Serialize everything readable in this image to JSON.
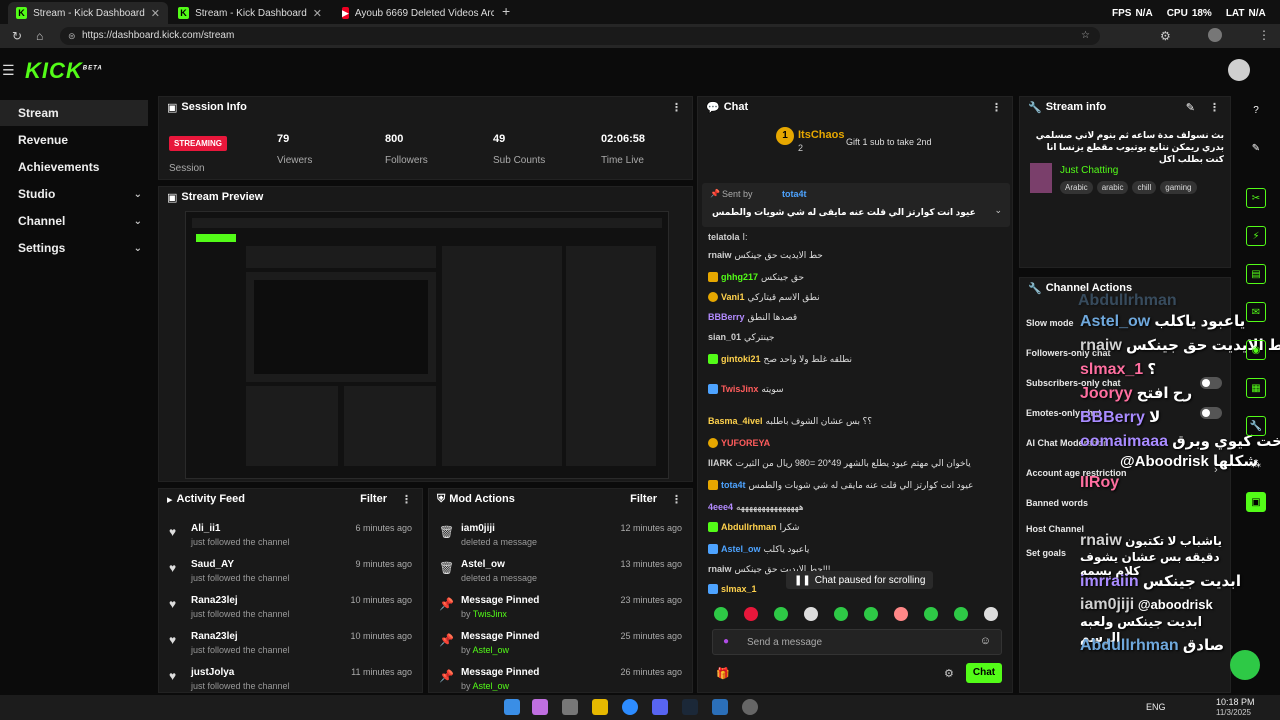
{
  "browser": {
    "tabs": [
      {
        "title": "Stream - Kick Dashboard"
      },
      {
        "title": "Stream - Kick Dashboard"
      },
      {
        "title": "Ayoub 6669 Deleted Videos Archi"
      }
    ],
    "url": "https://dashboard.kick.com/stream",
    "sys": {
      "fps": "FPS",
      "fps_val": "N/A",
      "cpu": "CPU",
      "cpu_val": "18%",
      "lat": "LAT",
      "lat_val": "N/A"
    }
  },
  "app": {
    "logo": "KICK",
    "logo_sup": "BETA",
    "accent": "#53fc18"
  },
  "sidebar": {
    "items": [
      {
        "label": "Stream"
      },
      {
        "label": "Revenue"
      },
      {
        "label": "Achievements"
      },
      {
        "label": "Studio"
      },
      {
        "label": "Channel"
      },
      {
        "label": "Settings"
      }
    ]
  },
  "session": {
    "title": "Session Info",
    "status": "STREAMING",
    "status_label": "Session",
    "stats": [
      {
        "value": "79",
        "label": "Viewers"
      },
      {
        "value": "800",
        "label": "Followers"
      },
      {
        "value": "49",
        "label": "Sub Counts"
      },
      {
        "value": "02:06:58",
        "label": "Time Live"
      }
    ]
  },
  "preview": {
    "title": "Stream Preview"
  },
  "activity": {
    "title": "Activity Feed",
    "filter": "Filter",
    "items": [
      {
        "name": "Ali_ii1",
        "sub": "just followed the channel",
        "time": "6 minutes ago"
      },
      {
        "name": "Saud_AY",
        "sub": "just followed the channel",
        "time": "9 minutes ago"
      },
      {
        "name": "Rana23lej",
        "sub": "just followed the channel",
        "time": "10 minutes ago"
      },
      {
        "name": "Rana23lej",
        "sub": "just followed the channel",
        "time": "10 minutes ago"
      },
      {
        "name": "justJolya",
        "sub": "just followed the channel",
        "time": "11 minutes ago"
      }
    ]
  },
  "mod": {
    "title": "Mod Actions",
    "filter": "Filter",
    "items": [
      {
        "name": "iam0jiji",
        "sub": "deleted a message",
        "by": "",
        "time": "12 minutes ago"
      },
      {
        "name": "Astel_ow",
        "sub": "deleted a message",
        "by": "",
        "time": "13 minutes ago"
      },
      {
        "name": "Message Pinned",
        "sub": "by ",
        "by": "TwisJinx",
        "time": "23 minutes ago"
      },
      {
        "name": "Message Pinned",
        "sub": "by ",
        "by": "Astel_ow",
        "time": "25 minutes ago"
      },
      {
        "name": "Message Pinned",
        "sub": "by ",
        "by": "Astel_ow",
        "time": "26 minutes ago"
      }
    ]
  },
  "chat": {
    "title": "Chat",
    "top_user": "ItsChaos",
    "top_count": "2",
    "gift": "Gift 1 sub to take 2nd",
    "pinned_sent_by": "Sent by",
    "pinned_user": "tota4t",
    "pinned_msg": "عيود انت كوارتز الي قلت عنه مايقى له شي شويات والطمس",
    "messages": [
      {
        "user": "telatola",
        "text": "ا:",
        "color": "#cfcfcf"
      },
      {
        "user": "rnaiw",
        "text": "حط الايديت حق جينكس",
        "color": "#cfcfcf"
      },
      {
        "user": "ghhg217",
        "text": "حق جينكس",
        "color": "#53fc18"
      },
      {
        "user": "Vani1",
        "text": "نطق الاسم قيتاركي",
        "color": "#ffd24d"
      },
      {
        "user": "BBBerry",
        "text": "قصدها النطق",
        "color": "#b38bff"
      },
      {
        "user": "sian_01",
        "text": "جينتركي",
        "color": "#cfcfcf"
      },
      {
        "user": "gintoki21",
        "text": "نطلقه غلط ولا واحد صح",
        "color": "#ffd24d"
      },
      {
        "user": "TwisJinx",
        "text": "سويته",
        "color": "#ff5c5c"
      },
      {
        "user": "Basma_4ivel",
        "text": "؟؟ بس عشان الشوف باطلبه",
        "color": "#ffd24d"
      },
      {
        "user": "YUFOREYA",
        "text": "",
        "color": "#ff5c5c"
      },
      {
        "user": "IIARK",
        "text": "ياخوان الي مهتم عيود يطلع بالشهر 49*20 =980 ريال من الثيرت",
        "color": "#cfcfcf"
      },
      {
        "user": "tota4t",
        "text": "عيود انت كوارتز الي قلت عنه مايقى له شي شويات والطمس",
        "color": "#4da3ff"
      },
      {
        "user": "4eee4",
        "text": "هههههههههههههههه",
        "color": "#b38bff"
      },
      {
        "user": "Abdullrhman",
        "text": "شكرا",
        "color": "#ffd24d"
      },
      {
        "user": "Astel_ow",
        "text": "ياعبود ياكلب",
        "color": "#4da3ff"
      },
      {
        "user": "rnaiw",
        "text": "حط الايديت حق جينكس!!!",
        "color": "#cfcfcf"
      },
      {
        "user": "slmax_1",
        "text": "",
        "color": "#ffd24d"
      }
    ],
    "paused": "Chat paused for scrolling",
    "placeholder": "Send a message",
    "send": "Chat"
  },
  "stream_info": {
    "title": "Stream info",
    "description": "بث نسولف مدة ساعه ثم بنوم لاني صسلمي بدري ريمكن نتابع يوتيوب مقطع يزنسا انا كنت بطلب اكل",
    "category": "Just Chatting",
    "tags": [
      "Arabic",
      "arabic",
      "chill",
      "gaming"
    ]
  },
  "channel_actions": {
    "title": "Channel Actions",
    "items": [
      {
        "label": "Slow mode"
      },
      {
        "label": "Followers-only chat"
      },
      {
        "label": "Subscribers-only chat"
      },
      {
        "label": "Emotes-only chat"
      },
      {
        "label": "AI Chat Moderation"
      },
      {
        "label": "Account age restriction"
      },
      {
        "label": "Banned words"
      },
      {
        "label": "Host Channel"
      },
      {
        "label": "Set goals"
      }
    ]
  },
  "overlay": [
    {
      "user": "Abdullrhman",
      "text": "",
      "color": "#6fa8dc"
    },
    {
      "user": "Astel_ow",
      "text": "ياعبود ياكلب",
      "color": "#6fa8dc"
    },
    {
      "user": "rnaiw",
      "text": "حط الايديت حق جينكس!!!",
      "color": "#d0d0d0"
    },
    {
      "user": "slmax_1",
      "text": "؟",
      "color": "#ff6fa0"
    },
    {
      "user": "Jooryy",
      "text": "رح افتح",
      "color": "#ff6fa0"
    },
    {
      "user": "BBBerry",
      "text": "لا",
      "color": "#a98bff"
    },
    {
      "user": "oomaimaaa",
      "text": "اخت كيوي وبرق",
      "color": "#a98bff"
    },
    {
      "user": "",
      "text": "@Aboodrisk شكلها",
      "color": "#ffffff"
    },
    {
      "user": "IIRoy",
      "text": "",
      "color": "#ff6fa0"
    },
    {
      "user": "rnaiw",
      "text": "ياشباب لا تكتبون دقيقه بس عشان يشوف كلام بسمه",
      "color": "#d0d0d0"
    },
    {
      "user": "imrraiin",
      "text": "ابديت جينكس",
      "color": "#a98bff"
    },
    {
      "user": "iam0jiji",
      "text": "@aboodrisk ابديت جينكس ولعبه الرسم",
      "color": "#d0d0d0"
    },
    {
      "user": "Abdullrhman",
      "text": "صادق",
      "color": "#6fa8dc"
    }
  ],
  "taskbar": {
    "lang": "ENG",
    "time": "10:18 PM",
    "date": "11/3/2025"
  }
}
